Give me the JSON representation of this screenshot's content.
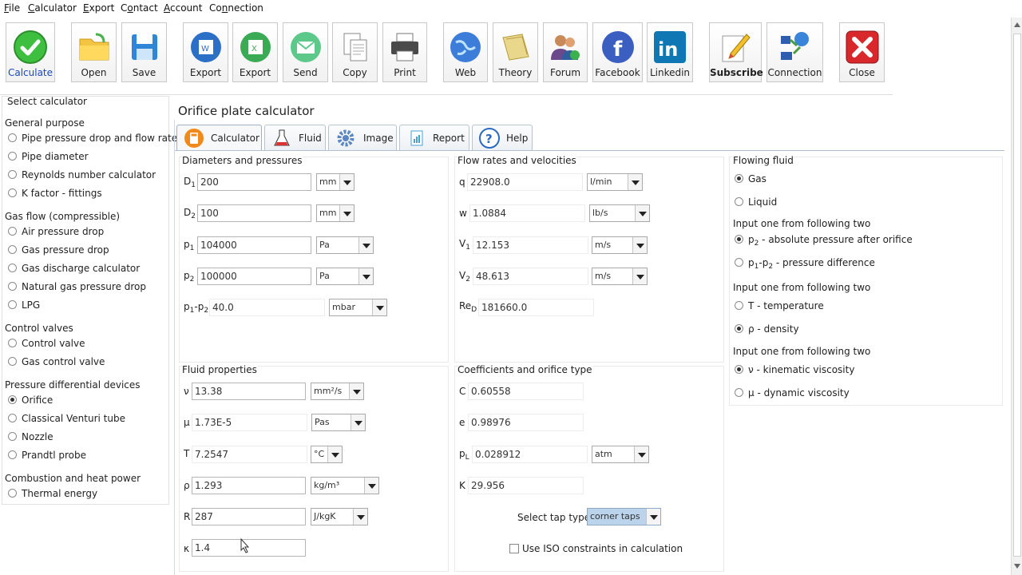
{
  "menu": [
    "File",
    "Calculator",
    "Export",
    "Contact",
    "Account",
    "Connection"
  ],
  "menu_underline": [
    "F",
    "C",
    "E",
    "o",
    "A",
    "n"
  ],
  "toolbar": [
    "Calculate",
    "Open",
    "Save",
    "Export",
    "Export",
    "Send",
    "Copy",
    "Print",
    "Web",
    "Theory",
    "Forum",
    "Facebook",
    "Linkedin",
    "Subscribe",
    "Connection",
    "Close"
  ],
  "sidebar": {
    "title": "Select calculator",
    "groups": [
      {
        "label": "General purpose",
        "items": [
          "Pipe pressure drop and flow rate",
          "Pipe diameter",
          "Reynolds number calculator",
          "K factor - fittings"
        ]
      },
      {
        "label": "Gas flow (compressible)",
        "items": [
          "Air pressure drop",
          "Gas pressure drop",
          "Gas discharge calculator",
          "Natural gas pressure drop",
          "LPG"
        ]
      },
      {
        "label": "Control valves",
        "items": [
          "Control valve",
          "Gas control valve"
        ]
      },
      {
        "label": "Pressure differential devices",
        "items": [
          "Orifice",
          "Classical Venturi tube",
          "Nozzle",
          "Prandtl probe"
        ]
      },
      {
        "label": "Combustion and heat power",
        "items": [
          "Thermal energy"
        ]
      }
    ],
    "selected": "Orifice"
  },
  "page_title": "Orifice plate calculator",
  "tabs": [
    "Calculator",
    "Fluid",
    "Image",
    "Report",
    "Help"
  ],
  "diam": {
    "title": "Diameters and pressures",
    "rows": [
      {
        "sym": "D",
        "sub": "1",
        "value": "200",
        "unit": "mm"
      },
      {
        "sym": "D",
        "sub": "2",
        "value": "100",
        "unit": "mm"
      },
      {
        "sym": "p",
        "sub": "1",
        "value": "104000",
        "unit": "Pa"
      },
      {
        "sym": "p",
        "sub": "2",
        "value": "100000",
        "unit": "Pa"
      },
      {
        "sym": "p",
        "sub": "1",
        "sym2": "-p",
        "sub2": "2",
        "value": "40.0",
        "unit": "mbar"
      }
    ]
  },
  "flow": {
    "title": "Flow rates and velocities",
    "rows": [
      {
        "sym": "q",
        "value": "22908.0",
        "unit": "l/min"
      },
      {
        "sym": "w",
        "value": "1.0884",
        "unit": "lb/s"
      },
      {
        "sym": "V",
        "sub": "1",
        "value": "12.153",
        "unit": "m/s"
      },
      {
        "sym": "V",
        "sub": "2",
        "value": "48.613",
        "unit": "m/s"
      },
      {
        "sym": "Re",
        "sub": "D",
        "value": "181660.0"
      }
    ]
  },
  "fluidprops": {
    "title": "Fluid properties",
    "rows": [
      {
        "sym": "ν",
        "value": "13.38",
        "unit": "mm²/s"
      },
      {
        "sym": "μ",
        "value": "1.73E-5",
        "unit": "Pas"
      },
      {
        "sym": "T",
        "value": "7.2547",
        "unit": "°C"
      },
      {
        "sym": "ρ",
        "value": "1.293",
        "unit": "kg/m³"
      },
      {
        "sym": "R",
        "value": "287",
        "unit": "J/kgK"
      },
      {
        "sym": "κ",
        "value": "1.4"
      }
    ]
  },
  "coef": {
    "title": "Coefficients and orifice type",
    "rows": [
      {
        "sym": "C",
        "value": "0.60558"
      },
      {
        "sym": "e",
        "value": "0.98976"
      },
      {
        "sym": "p",
        "sub": "L",
        "value": "0.028912",
        "unit": "atm"
      },
      {
        "sym": "K",
        "value": "29.956"
      }
    ],
    "tap_label": "Select tap type:",
    "tap_value": "corner taps",
    "iso_label": "Use ISO constraints in calculation"
  },
  "right": {
    "flowing_title": "Flowing fluid",
    "gas": "Gas",
    "liquid": "Liquid",
    "input_title": "Input one from following two",
    "p2_opt": {
      "a": "p",
      "sub": "2",
      "rest": " - absolute pressure after orifice"
    },
    "dp_opt": {
      "a": "p",
      "sub": "1",
      "b": "-p",
      "sub2": "2",
      "rest": " - pressure difference"
    },
    "t_opt": "T - temperature",
    "rho_opt": "ρ - density",
    "nu_opt": "ν - kinematic viscosity",
    "mu_opt": "μ - dynamic viscosity"
  }
}
